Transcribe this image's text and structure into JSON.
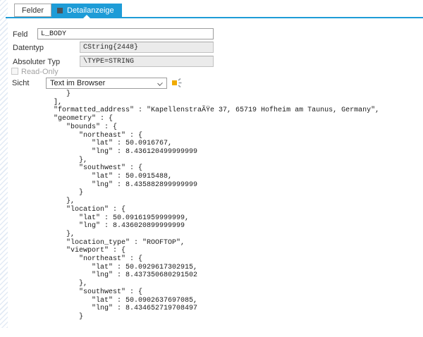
{
  "tabs": {
    "felder": {
      "label": "Felder"
    },
    "detailanzeige": {
      "label": "Detailanzeige"
    }
  },
  "form": {
    "feld": {
      "label": "Feld",
      "value": "L_BODY"
    },
    "datentyp": {
      "label": "Datentyp",
      "value": "CString{2448}"
    },
    "absoluter_typ": {
      "label": "Absoluter Typ",
      "value": "\\TYPE=STRING"
    },
    "read_only": {
      "label": "Read-Only",
      "checked": false
    },
    "sicht": {
      "label": "Sicht",
      "value": "Text im Browser"
    }
  },
  "icons": {
    "tab_square": "square-icon",
    "dropdown_chevron": "chevron-down-icon",
    "value_help": "orange-share-icon"
  },
  "colors": {
    "accent_blue": "#1e9cd7",
    "readonly_field_bg": "#ebebeb",
    "icon_orange": "#f0ab00",
    "tab_icon_gray": "#4d5359"
  },
  "viewer": {
    "json_lines": [
      "            }",
      "         ],",
      "         \"formatted_address\" : \"KapellenstraÃŸe 37, 65719 Hofheim am Taunus, Germany\",",
      "         \"geometry\" : {",
      "            \"bounds\" : {",
      "               \"northeast\" : {",
      "                  \"lat\" : 50.0916767,",
      "                  \"lng\" : 8.436120499999999",
      "               },",
      "               \"southwest\" : {",
      "                  \"lat\" : 50.0915488,",
      "                  \"lng\" : 8.435882899999999",
      "               }",
      "            },",
      "            \"location\" : {",
      "               \"lat\" : 50.09161959999999,",
      "               \"lng\" : 8.436020899999999",
      "            },",
      "            \"location_type\" : \"ROOFTOP\",",
      "            \"viewport\" : {",
      "               \"northeast\" : {",
      "                  \"lat\" : 50.0929617302915,",
      "                  \"lng\" : 8.437350680291502",
      "               },",
      "               \"southwest\" : {",
      "                  \"lat\" : 50.0902637697085,",
      "                  \"lng\" : 8.434652719708497",
      "               }"
    ]
  }
}
